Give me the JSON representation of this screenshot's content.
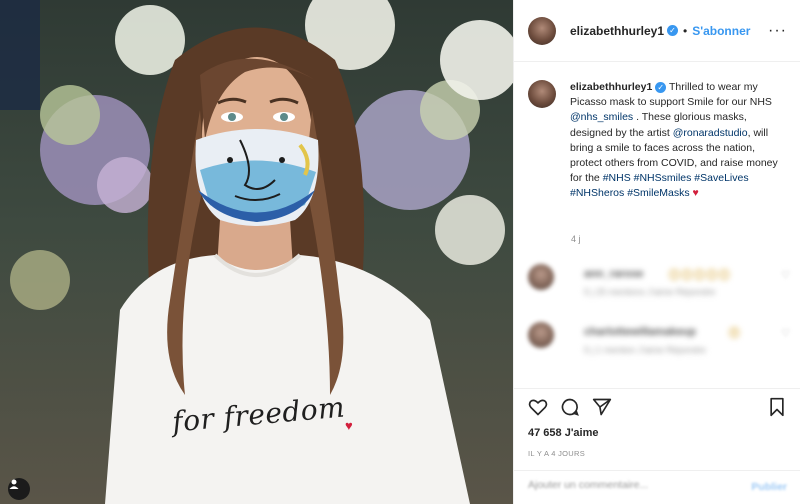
{
  "header": {
    "username": "elizabethhurley1",
    "separator": "•",
    "follow_label": "S'abonner",
    "more_label": "···"
  },
  "photo": {
    "shirt_text": "for freedom",
    "shirt_heart": "♥",
    "user_tag_icon": "person-icon"
  },
  "caption": {
    "username": "elizabethhurley1",
    "text_part1": " Thrilled to wear my Picasso mask to support Smile for our NHS ",
    "mention1": "@nhs_smiles",
    "text_part2": " . These glorious masks, designed by the artist ",
    "mention2": "@ronaradstudio",
    "text_part3": ", will bring a smile to faces across the nation, protect others from COVID, and raise money for the ",
    "hashtags": "#NHS #NHSsmiles #SaveLives #NHSheros #SmileMasks",
    "heart": "♥",
    "age": "4 j"
  },
  "comments": [
    {
      "name": "ann_rarose",
      "emojis": "😊😊😊😊😊",
      "meta": "5 j   25 mentions J'aime   Répondre"
    },
    {
      "name": "charlottewillamakeup",
      "emojis": "😍",
      "meta": "5 j   1 mention J'aime   Répondre"
    }
  ],
  "actions": {
    "like_icon": "heart-icon",
    "comment_icon": "comment-icon",
    "share_icon": "share-icon",
    "save_icon": "bookmark-icon"
  },
  "likes": {
    "count_label": "47 658 J'aime",
    "date": "IL Y A 4 JOURS"
  },
  "comment_bar": {
    "placeholder": "Ajouter un commentaire...",
    "publish_label": "Publier"
  },
  "colors": {
    "link_blue": "#3897f0",
    "hashtag_blue": "#003569",
    "heart_red": "#d21f3c"
  }
}
